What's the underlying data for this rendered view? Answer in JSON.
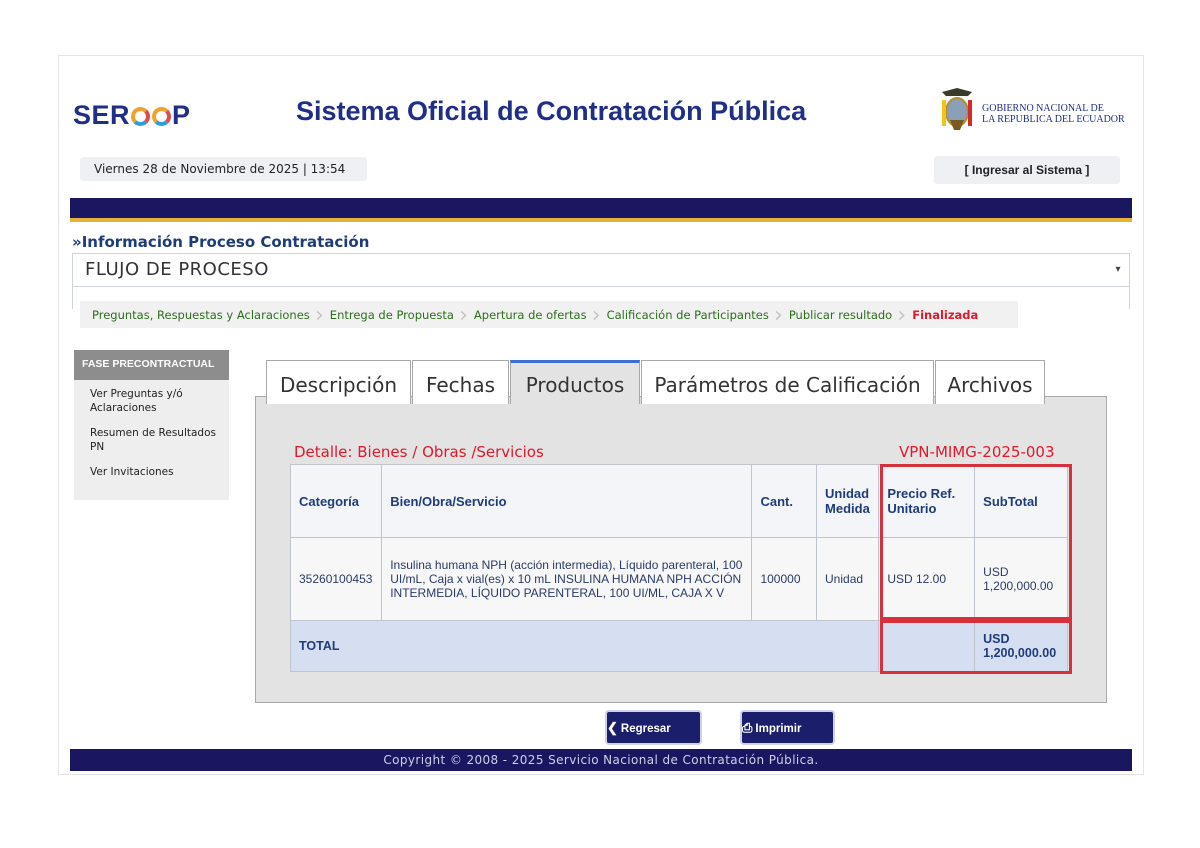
{
  "header": {
    "logo_pre": "SER",
    "logo_post": "P",
    "title": "Sistema Oficial de Contratación Pública",
    "gov_line1": "GOBIERNO NACIONAL DE",
    "gov_line2": "LA REPUBLICA DEL ECUADOR",
    "date_time": "Viernes 28 de Noviembre de 2025 | 13:54",
    "login_label": "[ Ingresar al Sistema ]"
  },
  "process": {
    "section_title": "»Información Proceso Contratación",
    "flow_value": "FLUJO DE PROCESO",
    "steps": [
      "Preguntas, Respuestas y Aclaraciones",
      "Entrega de Propuesta",
      "Apertura de ofertas",
      "Calificación de Participantes",
      "Publicar resultado",
      "Finalizada"
    ]
  },
  "sidebar": {
    "heading": "FASE PRECONTRACTUAL",
    "items": [
      "Ver Preguntas y/ó Aclaraciones",
      "Resumen de Resultados PN",
      "Ver Invitaciones"
    ]
  },
  "tabs": [
    "Descripción",
    "Fechas",
    "Productos",
    "Parámetros de Calificación",
    "Archivos"
  ],
  "active_tab": "Productos",
  "detail": {
    "label": "Detalle: Bienes / Obras /Servicios",
    "code": "VPN-MIMG-2025-003",
    "columns": [
      "Categoría",
      "Bien/Obra/Servicio",
      "Cant.",
      "Unidad Medida",
      "Precio Ref. Unitario",
      "SubTotal"
    ],
    "rows": [
      {
        "categoria": "35260100453",
        "descripcion": "Insulina humana NPH (acción intermedia), Líquido parenteral, 100 UI/mL, Caja x vial(es) x 10 mL INSULINA HUMANA NPH ACCIÓN INTERMEDIA, LÍQUIDO PARENTERAL, 100 UI/ML, CAJA X V",
        "cantidad": "100000",
        "unidad": "Unidad",
        "precio": "USD 12.00",
        "subtotal": "USD 1,200,000.00"
      }
    ],
    "total_label": "TOTAL",
    "total_value": "USD 1,200,000.00"
  },
  "buttons": {
    "back": "Regresar",
    "print": "Imprimir"
  },
  "footer": "Copyright © 2008 - 2025 Servicio Nacional de Contratación Pública.",
  "colors": {
    "brand_navy": "#1b1660",
    "accent_gold": "#e8b23a",
    "alert_red": "#e0192b",
    "highlight_red": "#d6313a"
  }
}
